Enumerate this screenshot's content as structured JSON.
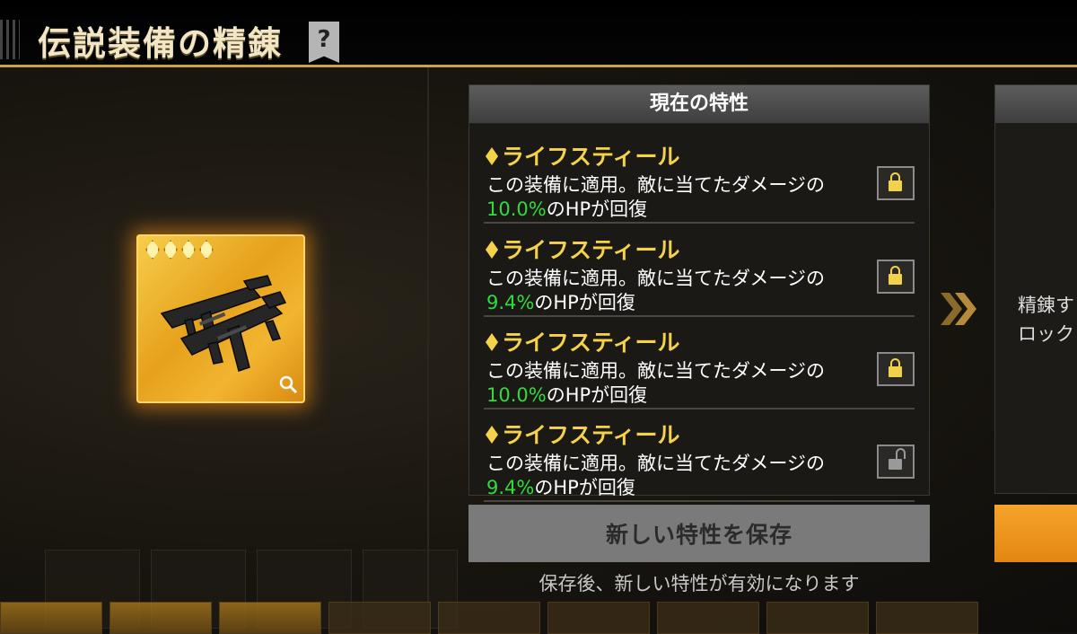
{
  "header": {
    "title": "伝説装備の精錬",
    "help_glyph": "?"
  },
  "item": {
    "rarity_stars": 4,
    "icon": "smg-weapon-icon",
    "zoom": "zoom-icon"
  },
  "current_traits": {
    "title": "現在の特性",
    "traits": [
      {
        "name": "ライフスティール",
        "desc_line1": "この装備に適用。敵に当てたダメージの",
        "value": "10.0%",
        "desc_tail": "のHPが回復",
        "locked": true
      },
      {
        "name": "ライフスティール",
        "desc_line1": "この装備に適用。敵に当てたダメージの",
        "value": "9.4%",
        "desc_tail": "のHPが回復",
        "locked": true
      },
      {
        "name": "ライフスティール",
        "desc_line1": "この装備に適用。敵に当てたダメージの",
        "value": "10.0%",
        "desc_tail": "のHPが回復",
        "locked": true
      },
      {
        "name": "ライフスティール",
        "desc_line1": "この装備に適用。敵に当てたダメージの",
        "value": "9.4%",
        "desc_tail": "のHPが回復",
        "locked": false
      }
    ]
  },
  "save": {
    "label": "新しい特性を保存",
    "note": "保存後、新しい特性が有効になります"
  },
  "new_traits_panel": {
    "line1": "精錬す",
    "line2": "ロック"
  },
  "colors": {
    "accent_gold": "#c9a24a",
    "trait_name": "#f5d24a",
    "value_green": "#2fdc3b",
    "confirm_orange": "#e48712"
  }
}
